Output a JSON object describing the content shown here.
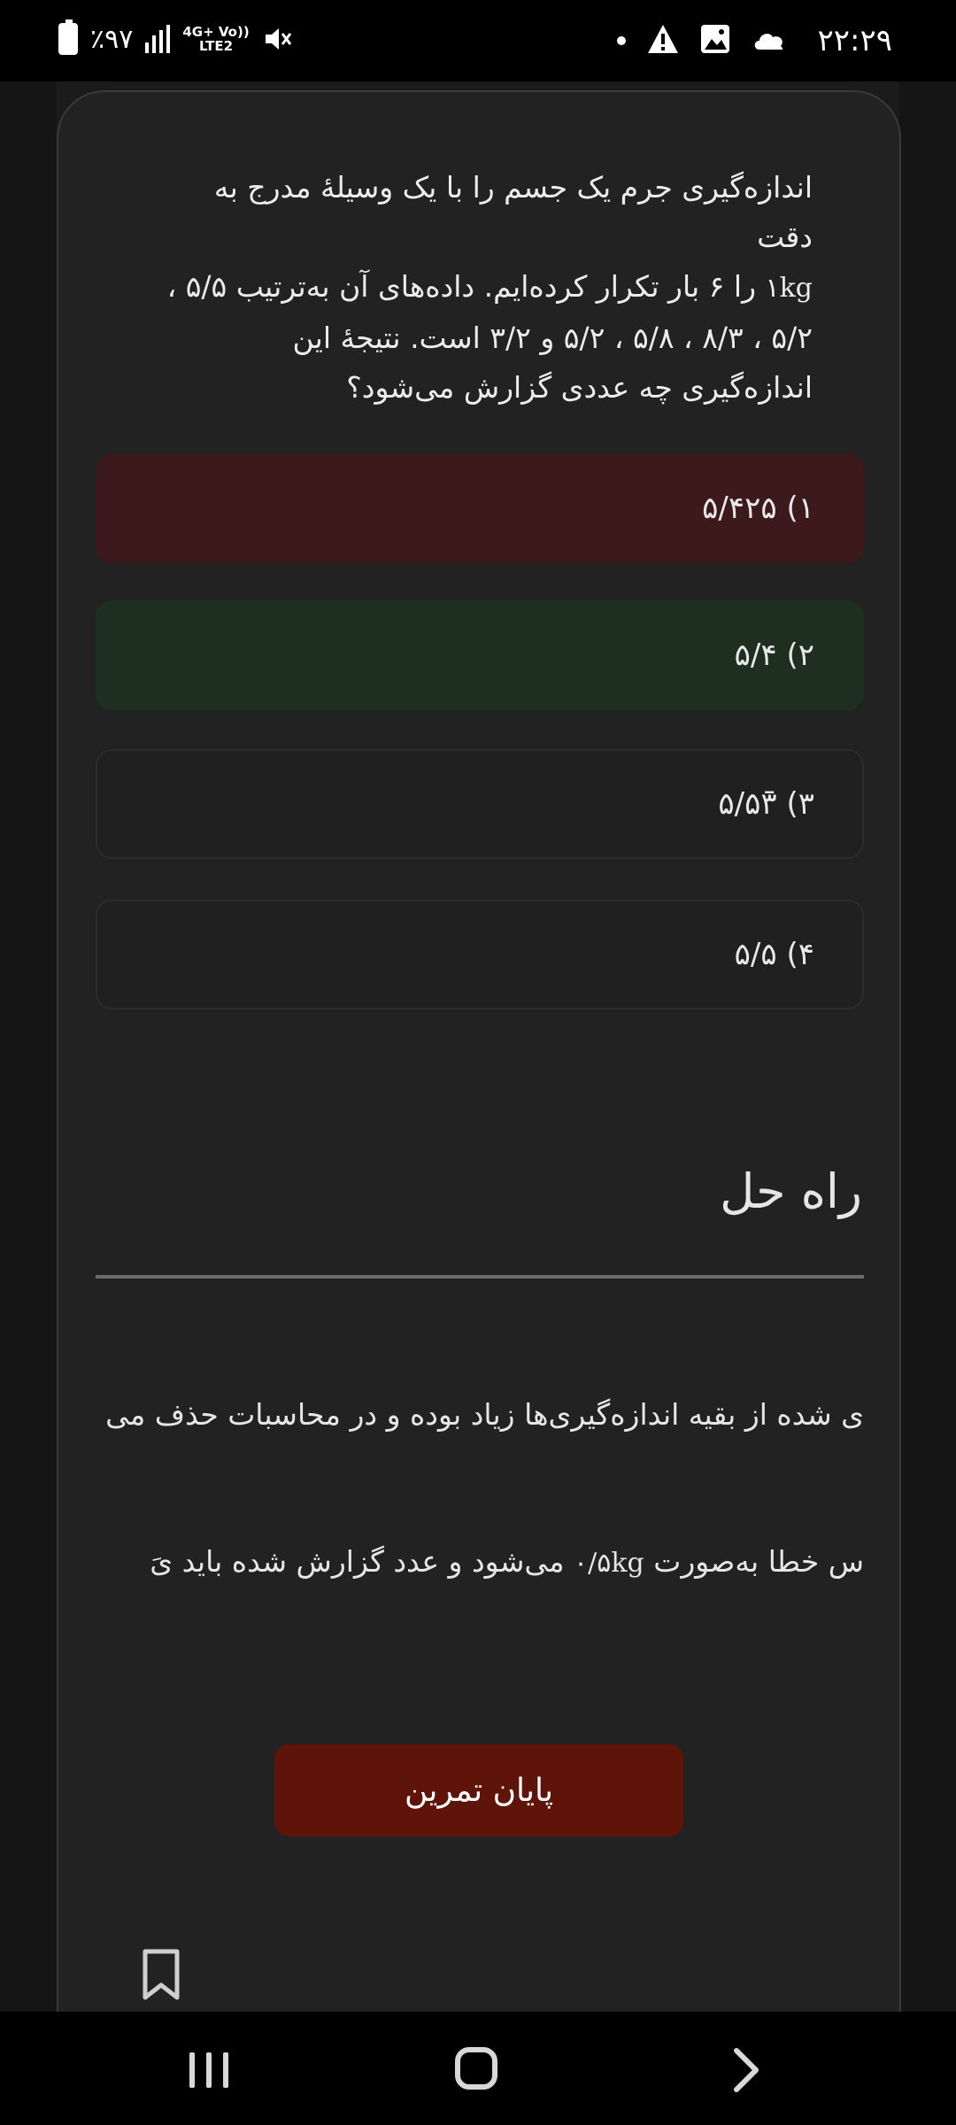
{
  "status_bar": {
    "time": "۲۲:۲۹",
    "battery": "٪۹۷",
    "network_top": "4G+ Vo))",
    "network_bottom": "LTE2"
  },
  "question": {
    "line1": "اندازه‌گیری جرم یک جسم را با یک وسیلهٔ مدرج به دقت",
    "line2_unit": "۱kg",
    "line2": " را ۶ بار تکرار کرده‌ایم. داده‌های آن به‌ترتیب  ۵/۵ ،",
    "line3": "۵/۲ ، ۸/۳ ، ۵/۸ ، ۵/۲ و ۳/۲ است. نتیجهٔ این",
    "line4": "اندازه‌گیری چه عددی گزارش می‌شود؟"
  },
  "options": [
    {
      "label": "۱) ۵/۴۲۵",
      "state": "wrong"
    },
    {
      "label": "۲) ۵/۴",
      "state": "correct"
    },
    {
      "label": "۳)   ۵/۵۳̄",
      "state": "neutral"
    },
    {
      "label": "۴) ۵/۵",
      "state": "neutral"
    }
  ],
  "solution": {
    "title": "راه حل",
    "line1": "ی شده از بقیه اندازه‌گیری‌ها زیاد بوده و در محاسبات حذف می",
    "line2_before": "س خطا به‌صورت ",
    "line2_unit": "۰/۵kg",
    "line2_after": " می‌شود و عدد گزارش شده باید یَ"
  },
  "finish_button": "پایان تمرین",
  "colors": {
    "wrong_option": "#3c1a1b",
    "correct_option": "#1e2e1f",
    "finish_button": "#5e1409"
  }
}
